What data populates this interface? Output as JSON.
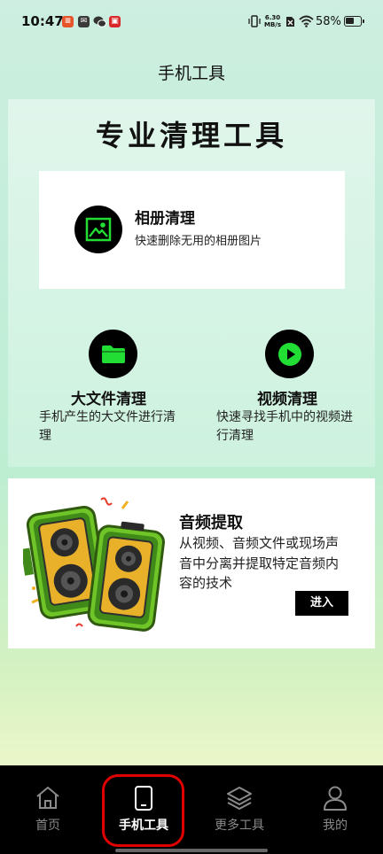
{
  "status_bar": {
    "time": "10:47",
    "net_speed_value": "6.30",
    "net_speed_unit": "MB/s",
    "battery_percent": "58%",
    "battery_level": 0.58
  },
  "header": {
    "title": "手机工具"
  },
  "pro_tools": {
    "heading": "专业清理工具",
    "album": {
      "title": "相册清理",
      "desc": "快速删除无用的相册图片",
      "icon": "photo-icon"
    },
    "large_file": {
      "title": "大文件清理",
      "desc_line1": "手机产生的大文件进行清",
      "desc_line2": "理",
      "icon": "folder-icon"
    },
    "video": {
      "title": "视频清理",
      "desc_line1": "快速寻找手机中的视频进",
      "desc_line2": "行清理",
      "icon": "play-icon"
    }
  },
  "audio_extract": {
    "title": "音频提取",
    "desc_line1": "从视频、音频文件或现场声",
    "desc_line2": "音中分离并提取特定音频内",
    "desc_line3": "容的技术",
    "button": "进入",
    "image": "speakers-illustration"
  },
  "tab_bar": {
    "tabs": [
      {
        "label": "首页",
        "icon": "home-icon",
        "active": false
      },
      {
        "label": "手机工具",
        "icon": "phone-icon",
        "active": true
      },
      {
        "label": "更多工具",
        "icon": "layers-icon",
        "active": false
      },
      {
        "label": "我的",
        "icon": "user-icon",
        "active": false
      }
    ]
  },
  "colors": {
    "accent_green": "#22dd33",
    "highlight_red": "#e00000"
  }
}
